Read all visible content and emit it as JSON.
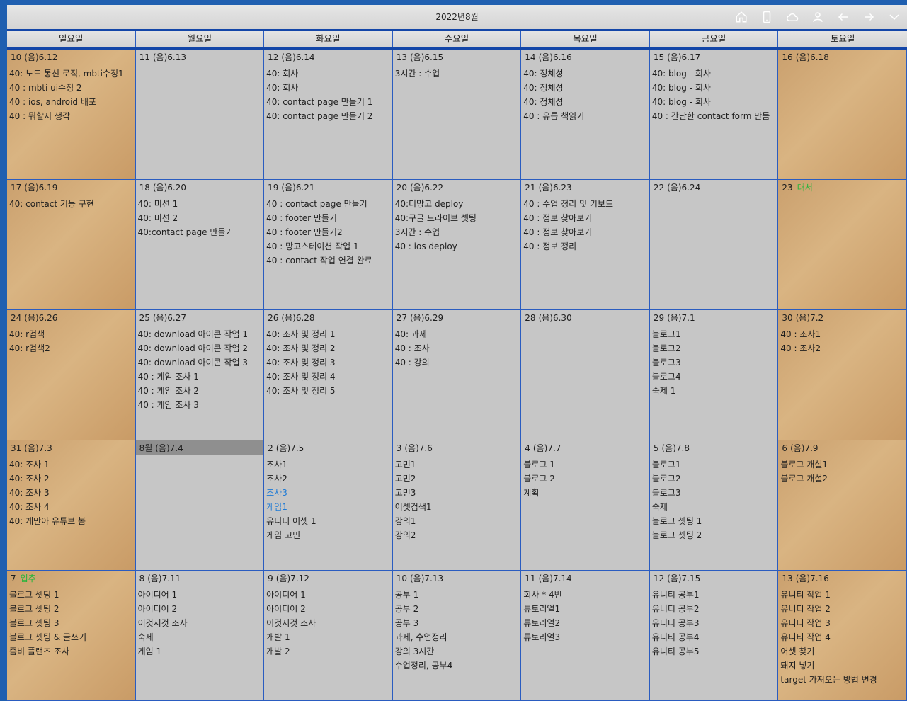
{
  "window": {
    "title": "2022년8월"
  },
  "toolbar": {
    "icons": [
      "home-icon",
      "phone-icon",
      "cloud-icon",
      "user-icon",
      "arrow-left-icon",
      "arrow-right-icon",
      "chevron-down-icon"
    ]
  },
  "weekdays": [
    "일요일",
    "월요일",
    "화요일",
    "수요일",
    "목요일",
    "금요일",
    "토요일"
  ],
  "weeks": [
    [
      {
        "day": "10",
        "lunar": "(음)6.12",
        "events": [
          {
            "t": "40: 노드 통신 로직, mbti수정1"
          },
          {
            "t": "40 : mbti ui수정 2"
          },
          {
            "t": "40 : ios, android 배포"
          },
          {
            "t": "40 : 뭐할지 생각"
          }
        ]
      },
      {
        "day": "11",
        "lunar": "(음)6.13",
        "events": []
      },
      {
        "day": "12",
        "lunar": "(음)6.14",
        "events": [
          {
            "t": "40: 회사"
          },
          {
            "t": "40: 회사"
          },
          {
            "t": "40: contact page 만들기 1"
          },
          {
            "t": "40: contact page 만들기 2"
          }
        ]
      },
      {
        "day": "13",
        "lunar": "(음)6.15",
        "events": [
          {
            "t": "3시간 : 수업"
          }
        ]
      },
      {
        "day": "14",
        "lunar": "(음)6.16",
        "events": [
          {
            "t": "40: 정체성"
          },
          {
            "t": "40: 정체성"
          },
          {
            "t": "40: 정체성"
          },
          {
            "t": "40 : 유틉 책읽기"
          }
        ]
      },
      {
        "day": "15",
        "lunar": "(음)6.17",
        "events": [
          {
            "t": "40: blog - 회사"
          },
          {
            "t": "40: blog - 회사"
          },
          {
            "t": "40: blog - 회사"
          },
          {
            "t": "40 : 간단한 contact form 만듬"
          }
        ]
      },
      {
        "day": "16",
        "lunar": "(음)6.18",
        "events": []
      }
    ],
    [
      {
        "day": "17",
        "lunar": "(음)6.19",
        "events": [
          {
            "t": "40: contact 기능 구현"
          }
        ]
      },
      {
        "day": "18",
        "lunar": "(음)6.20",
        "events": [
          {
            "t": "40: 미션 1"
          },
          {
            "t": "40: 미션 2"
          },
          {
            "t": "40:contact page  만들기"
          }
        ]
      },
      {
        "day": "19",
        "lunar": "(음)6.21",
        "events": [
          {
            "t": "40 : contact page 만들기"
          },
          {
            "t": "40 : footer 만들기"
          },
          {
            "t": "40 : footer 만들기2"
          },
          {
            "t": "40 : 망고스테이션 작업 1"
          },
          {
            "t": "40 : contact 작업 연결 완료"
          }
        ]
      },
      {
        "day": "20",
        "lunar": "(음)6.22",
        "events": [
          {
            "t": "40:디망고 deploy"
          },
          {
            "t": "40:구글 드라이브 셋팅"
          },
          {
            "t": "3시간 : 수업"
          },
          {
            "t": "40 : ios deploy"
          }
        ]
      },
      {
        "day": "21",
        "lunar": "(음)6.23",
        "events": [
          {
            "t": "40 : 수업 정리 및 키보드"
          },
          {
            "t": "40 : 정보 찾아보기"
          },
          {
            "t": "40 : 정보 찾아보기"
          },
          {
            "t": "40 : 정보 정리"
          }
        ]
      },
      {
        "day": "22",
        "lunar": "(음)6.24",
        "events": []
      },
      {
        "day": "23",
        "lunar": "",
        "highlight": "대서",
        "events": []
      }
    ],
    [
      {
        "day": "24",
        "lunar": "(음)6.26",
        "events": [
          {
            "t": "40: r검색"
          },
          {
            "t": "40: r검색2"
          }
        ]
      },
      {
        "day": "25",
        "lunar": "(음)6.27",
        "events": [
          {
            "t": "40: download 아이콘 작업 1"
          },
          {
            "t": "40: download 아이콘 작업 2"
          },
          {
            "t": "40: download 아이콘 작업 3"
          },
          {
            "t": "40 : 게임 조사 1"
          },
          {
            "t": "40 : 게임 조사 2"
          },
          {
            "t": "40 : 게임 조사 3"
          }
        ]
      },
      {
        "day": "26",
        "lunar": "(음)6.28",
        "events": [
          {
            "t": "40: 조사 및 정리 1"
          },
          {
            "t": "40: 조사 및 정리 2"
          },
          {
            "t": "40: 조사 및 정리 3"
          },
          {
            "t": "40: 조사 및 정리 4"
          },
          {
            "t": "40: 조사 및 정리 5"
          }
        ]
      },
      {
        "day": "27",
        "lunar": "(음)6.29",
        "events": [
          {
            "t": "40: 과제"
          },
          {
            "t": "40 : 조사"
          },
          {
            "t": "40 : 강의"
          }
        ]
      },
      {
        "day": "28",
        "lunar": "(음)6.30",
        "events": []
      },
      {
        "day": "29",
        "lunar": "(음)7.1",
        "events": [
          {
            "t": "블로그1"
          },
          {
            "t": "블로그2"
          },
          {
            "t": "블로그3"
          },
          {
            "t": "블로그4"
          },
          {
            "t": "숙제 1"
          }
        ]
      },
      {
        "day": "30",
        "lunar": "(음)7.2",
        "events": [
          {
            "t": "40 : 조사1"
          },
          {
            "t": "40 : 조사2"
          }
        ]
      }
    ],
    [
      {
        "day": "31",
        "lunar": "(음)7.3",
        "events": [
          {
            "t": "40: 조사 1"
          },
          {
            "t": "40: 조사 2"
          },
          {
            "t": "40: 조사 3"
          },
          {
            "t": "40: 조사 4"
          },
          {
            "t": "40: 게만아 유튜브 봄"
          }
        ]
      },
      {
        "day": "8월",
        "lunar": "(음)7.4",
        "today": true,
        "events": []
      },
      {
        "day": "2",
        "lunar": "(음)7.5",
        "events": [
          {
            "t": "조사1"
          },
          {
            "t": "조사2"
          },
          {
            "t": "조사3",
            "blue": true
          },
          {
            "t": "게임1",
            "blue": true
          },
          {
            "t": "유니티 어셋 1"
          },
          {
            "t": "게임 고민"
          }
        ]
      },
      {
        "day": "3",
        "lunar": "(음)7.6",
        "events": [
          {
            "t": "고민1"
          },
          {
            "t": "고민2"
          },
          {
            "t": "고민3"
          },
          {
            "t": "어셋검색1"
          },
          {
            "t": "강의1"
          },
          {
            "t": "강의2"
          }
        ]
      },
      {
        "day": "4",
        "lunar": "(음)7.7",
        "events": [
          {
            "t": "블로그 1"
          },
          {
            "t": "블로그 2"
          },
          {
            "t": "계획"
          }
        ]
      },
      {
        "day": "5",
        "lunar": "(음)7.8",
        "events": [
          {
            "t": "블로그1"
          },
          {
            "t": "블로그2"
          },
          {
            "t": "블로그3"
          },
          {
            "t": "숙제"
          },
          {
            "t": "블로그 셋팅 1"
          },
          {
            "t": "블로그 셋팅 2"
          }
        ]
      },
      {
        "day": "6",
        "lunar": "(음)7.9",
        "events": [
          {
            "t": "블로그 개설1"
          },
          {
            "t": "블로그 개설2"
          }
        ]
      }
    ],
    [
      {
        "day": "7",
        "lunar": "",
        "highlight": "입추",
        "events": [
          {
            "t": "블로그 셋팅 1"
          },
          {
            "t": "블로그 셋팅 2"
          },
          {
            "t": "블로그 셋팅 3"
          },
          {
            "t": "블로그 셋팅 & 글쓰기"
          },
          {
            "t": "좀비 플랜츠 조사"
          }
        ]
      },
      {
        "day": "8",
        "lunar": "(음)7.11",
        "events": [
          {
            "t": "아이디어 1"
          },
          {
            "t": "아이디어 2"
          },
          {
            "t": "이것저것 조사"
          },
          {
            "t": "숙제"
          },
          {
            "t": "게임 1"
          }
        ]
      },
      {
        "day": "9",
        "lunar": "(음)7.12",
        "events": [
          {
            "t": "아이디어 1"
          },
          {
            "t": "아이디어 2"
          },
          {
            "t": "이것저것 조사"
          },
          {
            "t": "개발 1"
          },
          {
            "t": "개발 2"
          }
        ]
      },
      {
        "day": "10",
        "lunar": "(음)7.13",
        "events": [
          {
            "t": "공부 1"
          },
          {
            "t": "공부 2"
          },
          {
            "t": "공부 3"
          },
          {
            "t": "과제, 수업정리"
          },
          {
            "t": "강의 3시간"
          },
          {
            "t": "수업정리, 공부4"
          }
        ]
      },
      {
        "day": "11",
        "lunar": "(음)7.14",
        "events": [
          {
            "t": "회사 * 4번"
          },
          {
            "t": "튜토리얼1"
          },
          {
            "t": "튜토리얼2"
          },
          {
            "t": "튜토리얼3"
          }
        ]
      },
      {
        "day": "12",
        "lunar": "(음)7.15",
        "events": [
          {
            "t": "유니티 공부1"
          },
          {
            "t": "유니티 공부2"
          },
          {
            "t": "유니티 공부3"
          },
          {
            "t": "유니티 공부4"
          },
          {
            "t": "유니티 공부5"
          }
        ]
      },
      {
        "day": "13",
        "lunar": "(음)7.16",
        "events": [
          {
            "t": "유니티 작업 1"
          },
          {
            "t": "유니티 작업 2"
          },
          {
            "t": "유니티 작업 3"
          },
          {
            "t": "유니티 작업 4"
          },
          {
            "t": "어셋 찾기"
          },
          {
            "t": "돼지 넣기"
          },
          {
            "t": "target 가져오는 방법 변경"
          }
        ]
      }
    ]
  ]
}
